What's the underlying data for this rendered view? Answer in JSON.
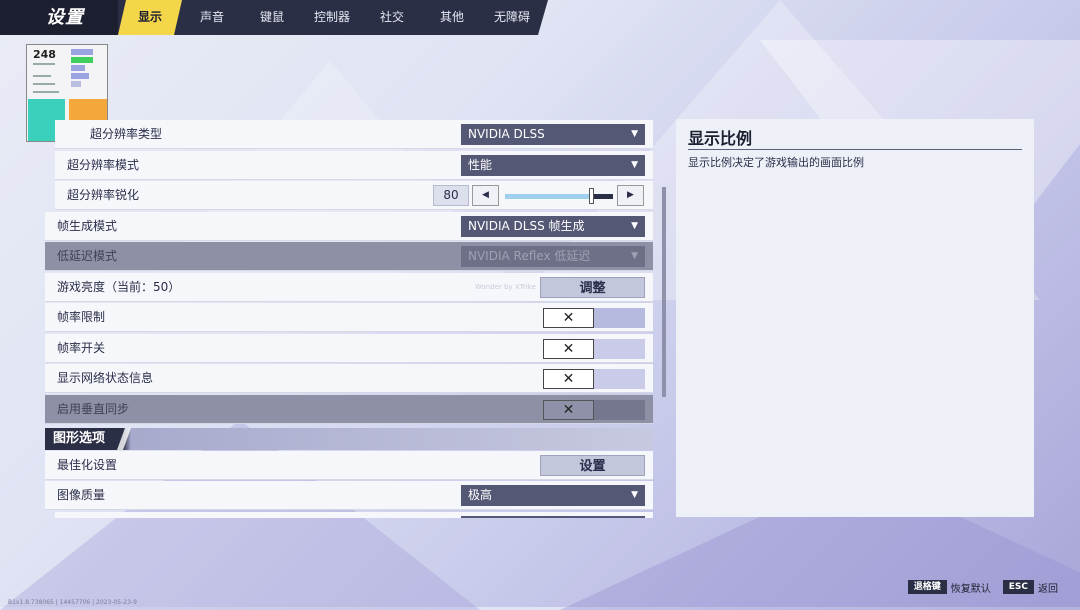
{
  "header": {
    "title": "设置",
    "tabs": [
      {
        "label": "显示",
        "active": true
      },
      {
        "label": "声音"
      },
      {
        "label": "键鼠"
      },
      {
        "label": "控制器"
      },
      {
        "label": "社交"
      },
      {
        "label": "其他"
      },
      {
        "label": "无障碍"
      }
    ]
  },
  "perf_overlay": {
    "fps": "248"
  },
  "settings": {
    "upscale_type": {
      "label": "超分辨率类型",
      "value": "NVIDIA DLSS"
    },
    "upscale_mode": {
      "label": "超分辨率模式",
      "value": "性能"
    },
    "upscale_sharpen": {
      "label": "超分辨率锐化",
      "value": "80",
      "level": 0.8
    },
    "frame_gen": {
      "label": "帧生成模式",
      "value": "NVIDIA DLSS 帧生成"
    },
    "low_latency": {
      "label": "低延迟模式",
      "value": "NVIDIA Reflex 低延迟"
    },
    "brightness": {
      "label": "游戏亮度（当前：50）",
      "button": "调整",
      "watermark": "Wonder by XTrike"
    },
    "fps_limit": {
      "label": "帧率限制",
      "toggle": "✕"
    },
    "fps_switch": {
      "label": "帧率开关",
      "toggle": "✕"
    },
    "net_info": {
      "label": "显示网络状态信息",
      "toggle": "✕"
    },
    "vsync": {
      "label": "启用垂直同步",
      "toggle": "✕"
    },
    "graphics_section": "图形选项",
    "optimize": {
      "label": "最佳化设置",
      "button": "设置"
    },
    "image_quality": {
      "label": "图像质量",
      "value": "极高"
    }
  },
  "description": {
    "title": "显示比例",
    "text": "显示比例决定了游戏输出的画面比例"
  },
  "footer": {
    "restore_key": "退格键",
    "restore_label": "恢复默认",
    "back_key": "ESC",
    "back_label": "返回"
  },
  "build_info": "B1x1.8.738065 | 14457706 | 2023-05-23-9"
}
